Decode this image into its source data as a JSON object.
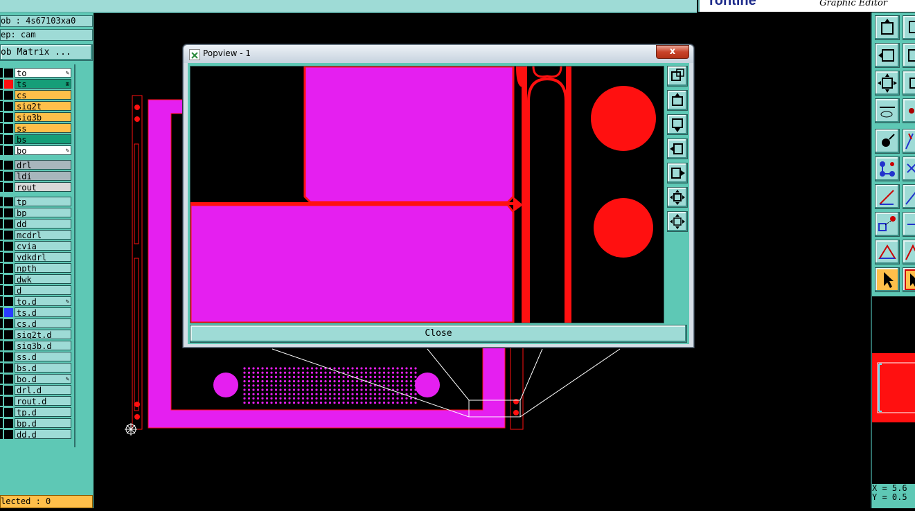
{
  "window": {
    "brand_logo": "rontine",
    "brand_subtitle": "Graphic Editor"
  },
  "left_panel": {
    "job_label": "ob : 4s67103xa0",
    "step_label": "ep: cam",
    "matrix_button": "ob Matrix ...",
    "selected_label": "lected : 0",
    "layers": [
      {
        "name": "to",
        "bg": "#ffffff",
        "mark": "✎",
        "color": "#000000"
      },
      {
        "name": "ts",
        "bg": "#159e78",
        "mark": "⊞",
        "color": "#ff1010"
      },
      {
        "name": "cs",
        "bg": "#ffbf4a",
        "mark": "",
        "color": "#000000"
      },
      {
        "name": "sig2t",
        "bg": "#ffbf4a",
        "mark": "",
        "color": "#000000"
      },
      {
        "name": "sig3b",
        "bg": "#ffbf4a",
        "mark": "",
        "color": "#000000"
      },
      {
        "name": "ss",
        "bg": "#ffbf4a",
        "mark": "",
        "color": "#000000"
      },
      {
        "name": "bs",
        "bg": "#159e78",
        "mark": "",
        "color": "#000000"
      },
      {
        "name": "bo",
        "bg": "#ffffff",
        "mark": "✎",
        "color": "#000000"
      },
      {
        "name": "drl",
        "bg": "#a8b6bc",
        "mark": "",
        "color": "#000000"
      },
      {
        "name": "ldi",
        "bg": "#a8b6bc",
        "mark": "",
        "color": "#000000"
      },
      {
        "name": "rout",
        "bg": "#d8d8d8",
        "mark": "",
        "color": "#000000"
      },
      {
        "name": "tp",
        "bg": "#9edbd6",
        "mark": "",
        "color": "#000000"
      },
      {
        "name": "bp",
        "bg": "#9edbd6",
        "mark": "",
        "color": "#000000"
      },
      {
        "name": "dd",
        "bg": "#9edbd6",
        "mark": "",
        "color": "#000000"
      },
      {
        "name": "mcdrl",
        "bg": "#9edbd6",
        "mark": "",
        "color": "#000000"
      },
      {
        "name": "cvia",
        "bg": "#9edbd6",
        "mark": "",
        "color": "#000000"
      },
      {
        "name": "ydkdrl",
        "bg": "#9edbd6",
        "mark": "",
        "color": "#000000"
      },
      {
        "name": "npth",
        "bg": "#9edbd6",
        "mark": "",
        "color": "#000000"
      },
      {
        "name": "dwk",
        "bg": "#9edbd6",
        "mark": "",
        "color": "#000000"
      },
      {
        "name": "d",
        "bg": "#9edbd6",
        "mark": "",
        "color": "#000000"
      },
      {
        "name": "to.d",
        "bg": "#9edbd6",
        "mark": "✎",
        "color": "#000000"
      },
      {
        "name": "ts.d",
        "bg": "#9edbd6",
        "mark": "",
        "color": "#2a3cff"
      },
      {
        "name": "cs.d",
        "bg": "#9edbd6",
        "mark": "",
        "color": "#000000"
      },
      {
        "name": "sig2t.d",
        "bg": "#9edbd6",
        "mark": "",
        "color": "#000000"
      },
      {
        "name": "sig3b.d",
        "bg": "#9edbd6",
        "mark": "",
        "color": "#000000"
      },
      {
        "name": "ss.d",
        "bg": "#9edbd6",
        "mark": "",
        "color": "#000000"
      },
      {
        "name": "bs.d",
        "bg": "#9edbd6",
        "mark": "",
        "color": "#000000"
      },
      {
        "name": "bo.d",
        "bg": "#9edbd6",
        "mark": "✎",
        "color": "#000000"
      },
      {
        "name": "drl.d",
        "bg": "#9edbd6",
        "mark": "",
        "color": "#000000"
      },
      {
        "name": "rout.d",
        "bg": "#9edbd6",
        "mark": "",
        "color": "#000000"
      },
      {
        "name": "tp.d",
        "bg": "#9edbd6",
        "mark": "",
        "color": "#000000"
      },
      {
        "name": "bp.d",
        "bg": "#9edbd6",
        "mark": "",
        "color": "#000000"
      },
      {
        "name": "dd.d",
        "bg": "#9edbd6",
        "mark": "",
        "color": "#000000"
      }
    ]
  },
  "popview": {
    "title": "Popview - 1",
    "close_x": "x",
    "close_button": "Close",
    "tools": [
      "zoom-window-icon",
      "pan-up-icon",
      "pan-down-icon",
      "pan-left-icon",
      "pan-right-icon",
      "zoom-fit-icon",
      "zoom-home-icon"
    ]
  },
  "right_panel": {
    "coordinates": "X = 5.6\nY = 0.5"
  },
  "colors": {
    "panel": "#5ec8b5",
    "button": "#9edbd6",
    "highlight": "#ffbf4a",
    "copper": "#e51ff0",
    "mask": "#ff1010"
  }
}
